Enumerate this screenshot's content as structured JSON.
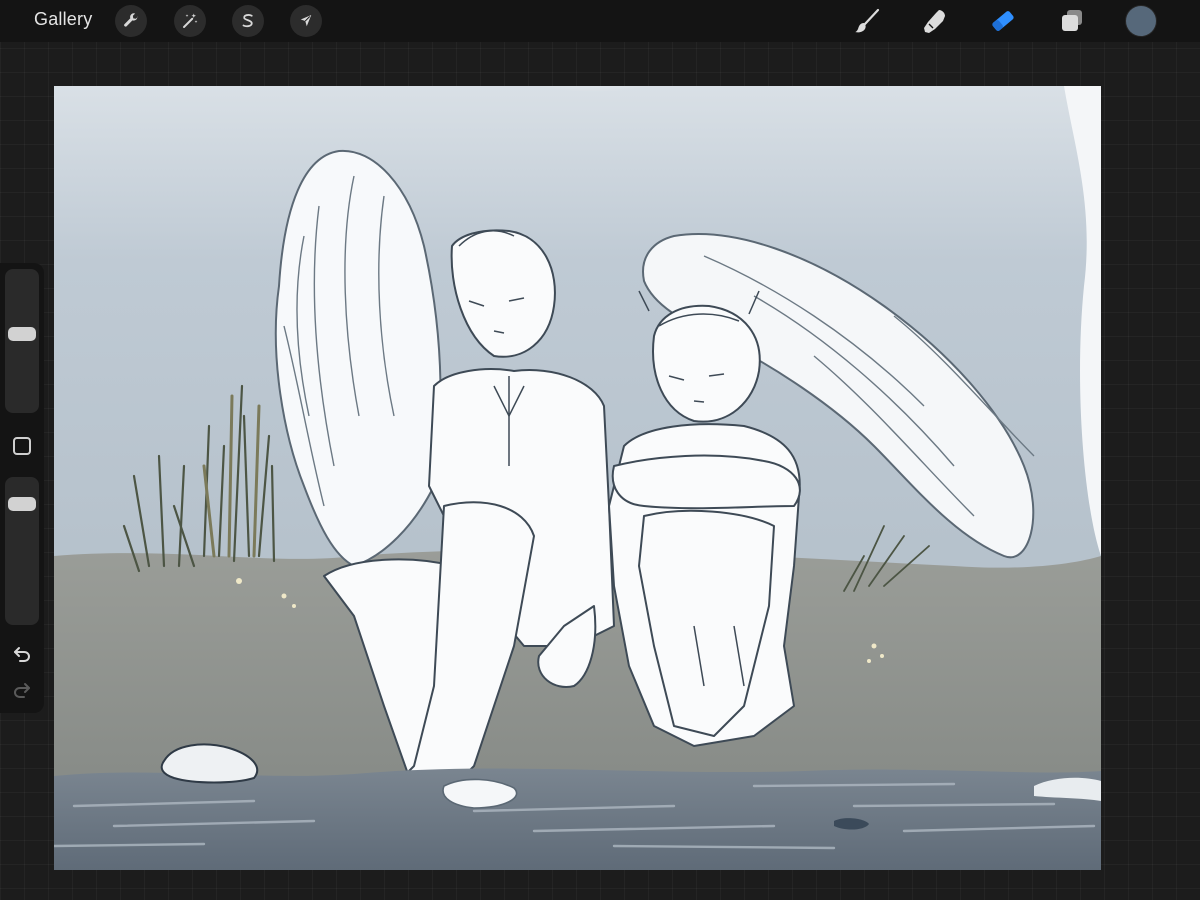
{
  "toolbar": {
    "gallery_label": "Gallery",
    "left_tools": [
      {
        "name": "actions",
        "icon": "wrench-icon"
      },
      {
        "name": "adjustments",
        "icon": "magic-wand-icon"
      },
      {
        "name": "selection",
        "icon": "selection-s-icon"
      },
      {
        "name": "transform",
        "icon": "arrow-cursor-icon"
      }
    ],
    "right_tools": [
      {
        "name": "brush",
        "icon": "brush-icon",
        "active": false
      },
      {
        "name": "smudge",
        "icon": "smudge-icon",
        "active": false
      },
      {
        "name": "eraser",
        "icon": "eraser-icon",
        "active": true
      },
      {
        "name": "layers",
        "icon": "layers-icon",
        "active": false
      }
    ],
    "current_color": "#56687a",
    "active_tool_color": "#2f8fff"
  },
  "sidebar": {
    "brush_size_level": 0.55,
    "opacity_level": 0.85,
    "modify_icon": "square-icon",
    "undo_icon": "undo-icon",
    "redo_icon": "redo-icon",
    "redo_enabled": false
  },
  "canvas": {
    "content": "sketch-artwork",
    "sky_color": "#c4ced7",
    "ground_color": "#8d918c",
    "water_color": "#6a7580"
  }
}
